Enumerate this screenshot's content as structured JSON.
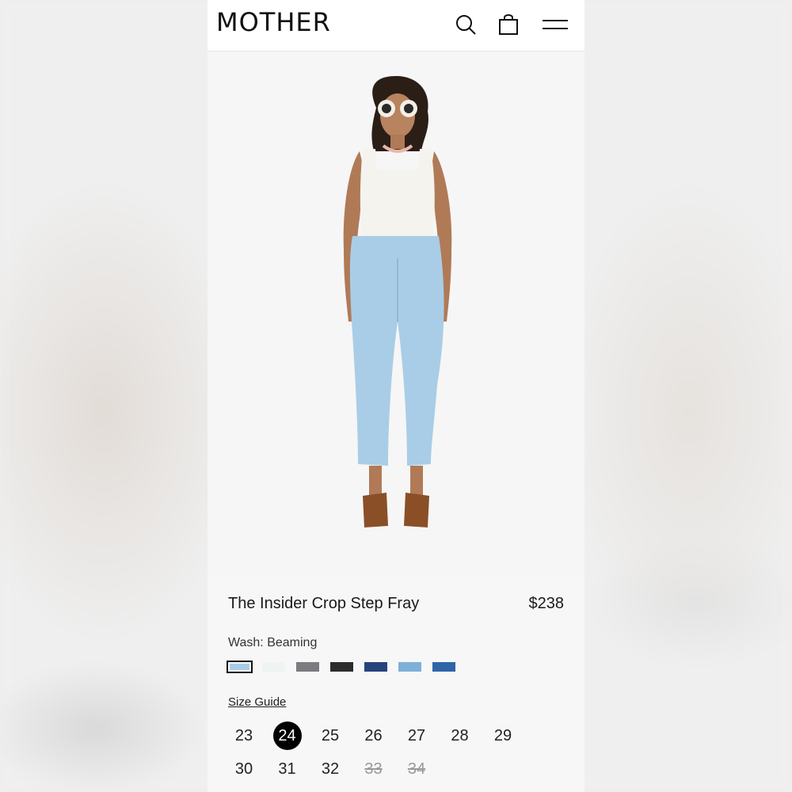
{
  "header": {
    "logo": "MOTHER",
    "icons": [
      "search-icon",
      "bag-icon",
      "menu-icon"
    ]
  },
  "product": {
    "name": "The Insider Crop Step Fray",
    "price": "$238",
    "wash_label": "Wash: Beaming",
    "swatches": [
      {
        "color": "#a9cde6",
        "selected": true
      },
      {
        "color": "#eef3f3",
        "selected": false
      },
      {
        "color": "#7b7b80",
        "selected": false
      },
      {
        "color": "#2c2c2c",
        "selected": false
      },
      {
        "color": "#27437d",
        "selected": false
      },
      {
        "color": "#7fb0d9",
        "selected": false
      },
      {
        "color": "#2f64a8",
        "selected": false
      }
    ],
    "size_guide": "Size Guide",
    "sizes": [
      {
        "label": "23",
        "state": "available"
      },
      {
        "label": "24",
        "state": "selected"
      },
      {
        "label": "25",
        "state": "available"
      },
      {
        "label": "26",
        "state": "available"
      },
      {
        "label": "27",
        "state": "available"
      },
      {
        "label": "28",
        "state": "available"
      },
      {
        "label": "29",
        "state": "available"
      },
      {
        "label": "30",
        "state": "available"
      },
      {
        "label": "31",
        "state": "available"
      },
      {
        "label": "32",
        "state": "available"
      },
      {
        "label": "33",
        "state": "unavailable"
      },
      {
        "label": "34",
        "state": "unavailable"
      }
    ]
  },
  "colors": {
    "accent": "#000000",
    "denim": "#a9cde6"
  }
}
